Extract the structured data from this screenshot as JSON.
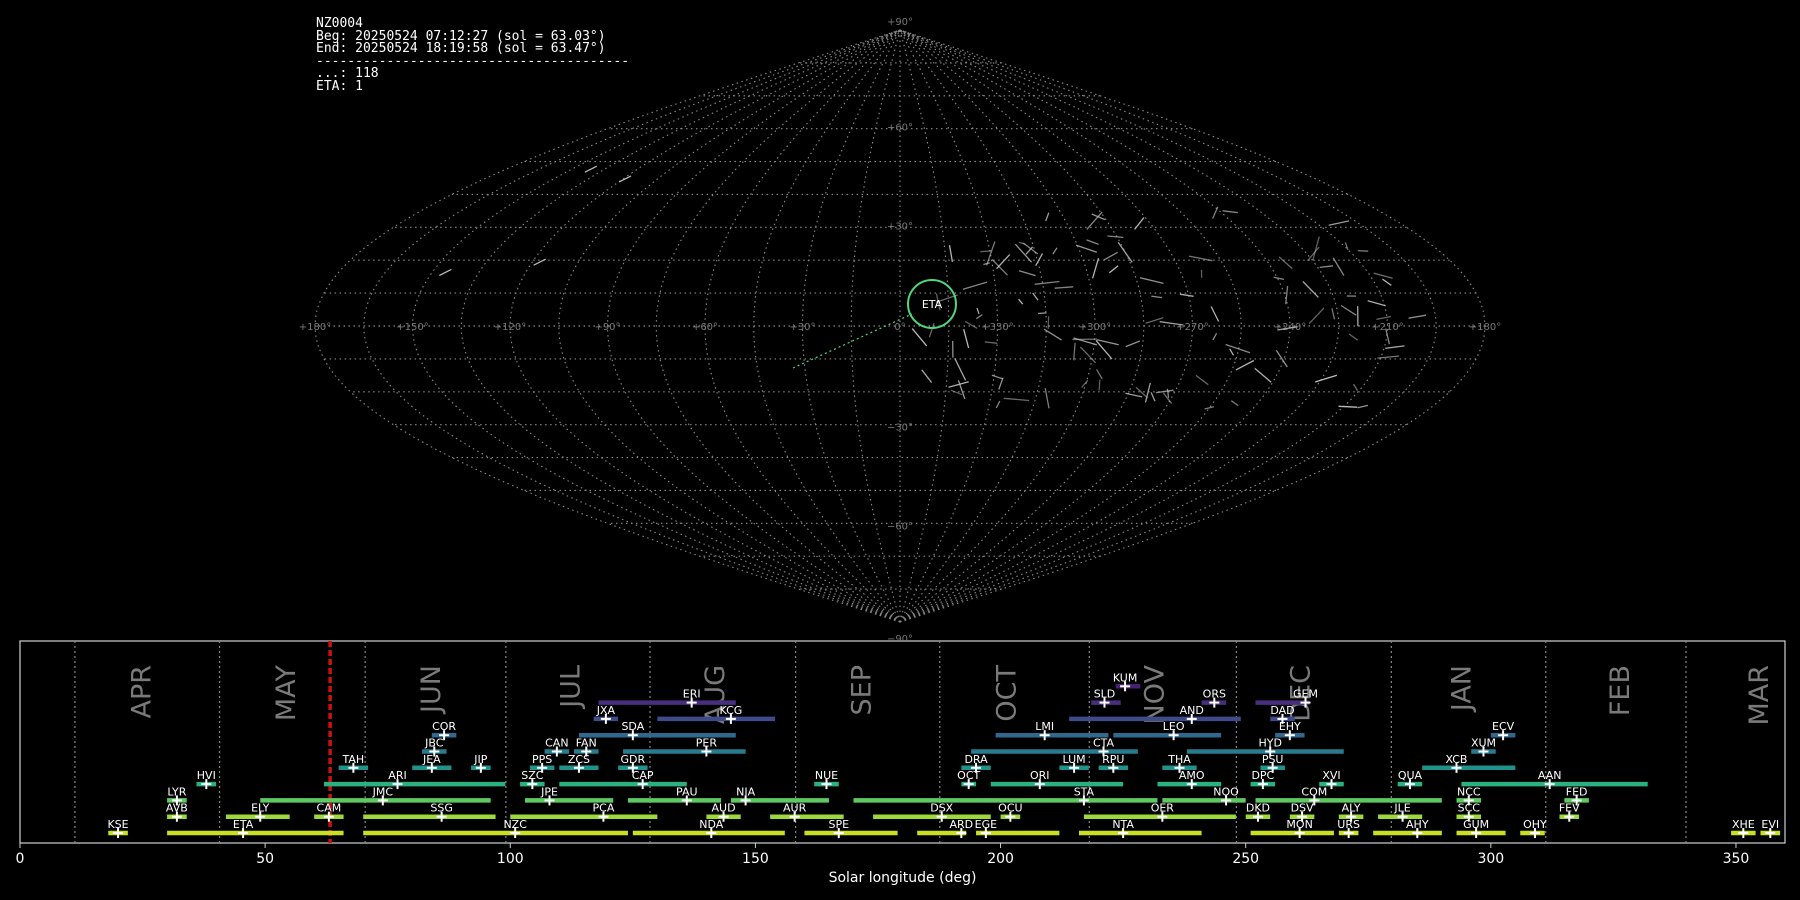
{
  "header": {
    "station": "NZ0004",
    "begin": "Beg: 20250524 07:12:27 (sol = 63.03°)",
    "end": "End: 20250524 18:19:58 (sol = 63.47°)",
    "separator": "----------------------------------------",
    "sporadic": "...: 118",
    "eta_count": "ETA: 1"
  },
  "sky_map": {
    "lat_labels": [
      "+90°",
      "+60°",
      "+30°",
      "0°",
      "−30°",
      "−60°",
      "−90°"
    ],
    "lon_labels": [
      "+180°",
      "+150°",
      "+120°",
      "+90°",
      "+60°",
      "+30°",
      "0°",
      "+330°",
      "+300°",
      "+270°",
      "+240°",
      "+210°",
      "+180°"
    ],
    "radiant_label": "ETA",
    "radiant_color": "#4fd77a",
    "grid_color": "#8a8a8a"
  },
  "chart_data": {
    "type": "timeline",
    "xlabel": "Solar longitude (deg)",
    "xlim": [
      0,
      360
    ],
    "xticks": [
      0,
      50,
      100,
      150,
      200,
      250,
      300,
      350
    ],
    "current_sol": 63.25,
    "current_sol_color": "#cc1111",
    "months": [
      {
        "name": "APR",
        "x": 24.6
      },
      {
        "name": "MAY",
        "x": 54.1
      },
      {
        "name": "JUN",
        "x": 83.6
      },
      {
        "name": "JUL",
        "x": 112.1
      },
      {
        "name": "AUG",
        "x": 141.6
      },
      {
        "name": "SEP",
        "x": 171.4
      },
      {
        "name": "OCT",
        "x": 201.0
      },
      {
        "name": "NOV",
        "x": 231.2
      },
      {
        "name": "DEC",
        "x": 261.0
      },
      {
        "name": "JAN",
        "x": 293.8
      },
      {
        "name": "FEB",
        "x": 326.1
      },
      {
        "name": "MAR",
        "x": 354.5
      }
    ],
    "month_boundaries": [
      11.2,
      40.7,
      70.4,
      99.1,
      128.5,
      158.2,
      187.6,
      218.1,
      248.1,
      279.7,
      311.2,
      339.8
    ],
    "showers": [
      {
        "code": "KUM",
        "start": 223.5,
        "end": 228.5,
        "peak": 225.4,
        "row": 10
      },
      {
        "code": "SLD",
        "start": 218.5,
        "end": 224.5,
        "peak": 221.2,
        "row": 9
      },
      {
        "code": "ORS",
        "start": 241.0,
        "end": 246.0,
        "peak": 243.6,
        "row": 9
      },
      {
        "code": "GEM",
        "start": 252.0,
        "end": 263.0,
        "peak": 262.2,
        "row": 9
      },
      {
        "code": "ERI",
        "start": 118.0,
        "end": 146.0,
        "peak": 137.0,
        "row": 9
      },
      {
        "code": "JXA",
        "start": 117.0,
        "end": 122.0,
        "peak": 119.5,
        "row": 8
      },
      {
        "code": "KCG",
        "start": 130.0,
        "end": 154.0,
        "peak": 145.0,
        "row": 8
      },
      {
        "code": "AND",
        "start": 214.0,
        "end": 249.0,
        "peak": 239.0,
        "row": 8
      },
      {
        "code": "DAD",
        "start": 255.0,
        "end": 260.0,
        "peak": 257.5,
        "row": 8
      },
      {
        "code": "COR",
        "start": 84.0,
        "end": 89.0,
        "peak": 86.5,
        "row": 7
      },
      {
        "code": "SDA",
        "start": 114.0,
        "end": 146.0,
        "peak": 125.0,
        "row": 7
      },
      {
        "code": "LMI",
        "start": 199.0,
        "end": 222.0,
        "peak": 209.0,
        "row": 7
      },
      {
        "code": "LEO",
        "start": 223.0,
        "end": 245.0,
        "peak": 235.3,
        "row": 7
      },
      {
        "code": "EHY",
        "start": 256.0,
        "end": 262.0,
        "peak": 259.0,
        "row": 7
      },
      {
        "code": "ECV",
        "start": 300.0,
        "end": 305.0,
        "peak": 302.5,
        "row": 7
      },
      {
        "code": "JBC",
        "start": 82.0,
        "end": 87.0,
        "peak": 84.5,
        "row": 6
      },
      {
        "code": "CAN",
        "start": 107.0,
        "end": 112.0,
        "peak": 109.5,
        "row": 6
      },
      {
        "code": "FAN",
        "start": 113.0,
        "end": 118.0,
        "peak": 115.5,
        "row": 6
      },
      {
        "code": "PER",
        "start": 123.0,
        "end": 148.0,
        "peak": 140.0,
        "row": 6
      },
      {
        "code": "CTA",
        "start": 194.0,
        "end": 228.0,
        "peak": 221.0,
        "row": 6
      },
      {
        "code": "HYD",
        "start": 238.0,
        "end": 270.0,
        "peak": 255.0,
        "row": 6
      },
      {
        "code": "XUM",
        "start": 296.0,
        "end": 301.0,
        "peak": 298.5,
        "row": 6
      },
      {
        "code": "TAH",
        "start": 65.0,
        "end": 71.0,
        "peak": 68.0,
        "row": 5
      },
      {
        "code": "JEA",
        "start": 80.0,
        "end": 88.0,
        "peak": 84.0,
        "row": 5
      },
      {
        "code": "JIP",
        "start": 92.0,
        "end": 96.0,
        "peak": 94.0,
        "row": 5
      },
      {
        "code": "PPS",
        "start": 104.0,
        "end": 109.0,
        "peak": 106.5,
        "row": 5
      },
      {
        "code": "ZCS",
        "start": 110.0,
        "end": 118.0,
        "peak": 114.0,
        "row": 5
      },
      {
        "code": "GDR",
        "start": 122.0,
        "end": 128.0,
        "peak": 125.0,
        "row": 5
      },
      {
        "code": "DRA",
        "start": 192.0,
        "end": 198.0,
        "peak": 195.0,
        "row": 5
      },
      {
        "code": "LUM",
        "start": 212.0,
        "end": 218.0,
        "peak": 215.0,
        "row": 5
      },
      {
        "code": "RPU",
        "start": 220.0,
        "end": 226.0,
        "peak": 223.0,
        "row": 5
      },
      {
        "code": "THA",
        "start": 233.0,
        "end": 240.0,
        "peak": 236.5,
        "row": 5
      },
      {
        "code": "PSU",
        "start": 253.0,
        "end": 258.0,
        "peak": 255.5,
        "row": 5
      },
      {
        "code": "XCB",
        "start": 286.0,
        "end": 305.0,
        "peak": 293.0,
        "row": 5
      },
      {
        "code": "HVI",
        "start": 36.0,
        "end": 40.0,
        "peak": 38.0,
        "row": 4
      },
      {
        "code": "ARI",
        "start": 62.0,
        "end": 99.0,
        "peak": 77.0,
        "row": 4
      },
      {
        "code": "SZC",
        "start": 102.0,
        "end": 107.0,
        "peak": 104.5,
        "row": 4
      },
      {
        "code": "CAP",
        "start": 110.0,
        "end": 136.0,
        "peak": 127.0,
        "row": 4
      },
      {
        "code": "NUE",
        "start": 162.0,
        "end": 167.0,
        "peak": 164.5,
        "row": 4
      },
      {
        "code": "OCT",
        "start": 192.0,
        "end": 195.0,
        "peak": 193.5,
        "row": 4
      },
      {
        "code": "ORI",
        "start": 198.0,
        "end": 225.0,
        "peak": 208.0,
        "row": 4
      },
      {
        "code": "AMO",
        "start": 232.0,
        "end": 245.0,
        "peak": 239.0,
        "row": 4
      },
      {
        "code": "DPC",
        "start": 251.0,
        "end": 256.0,
        "peak": 253.5,
        "row": 4
      },
      {
        "code": "XVI",
        "start": 265.0,
        "end": 270.0,
        "peak": 267.5,
        "row": 4
      },
      {
        "code": "QUA",
        "start": 281.0,
        "end": 286.0,
        "peak": 283.5,
        "row": 4
      },
      {
        "code": "AAN",
        "start": 294.0,
        "end": 332.0,
        "peak": 312.0,
        "row": 4
      },
      {
        "code": "LYR",
        "start": 30.0,
        "end": 34.0,
        "peak": 32.0,
        "row": 3
      },
      {
        "code": "JMC",
        "start": 49.0,
        "end": 96.0,
        "peak": 74.0,
        "row": 3
      },
      {
        "code": "JPE",
        "start": 103.0,
        "end": 121.0,
        "peak": 108.0,
        "row": 3
      },
      {
        "code": "PAU",
        "start": 124.0,
        "end": 143.0,
        "peak": 136.0,
        "row": 3
      },
      {
        "code": "NIA",
        "start": 145.0,
        "end": 165.0,
        "peak": 148.0,
        "row": 3
      },
      {
        "code": "STA",
        "start": 170.0,
        "end": 232.0,
        "peak": 217.0,
        "row": 3
      },
      {
        "code": "NOO",
        "start": 233.0,
        "end": 250.0,
        "peak": 246.0,
        "row": 3
      },
      {
        "code": "COM",
        "start": 252.0,
        "end": 290.0,
        "peak": 264.0,
        "row": 3
      },
      {
        "code": "NCC",
        "start": 293.0,
        "end": 298.0,
        "peak": 295.5,
        "row": 3
      },
      {
        "code": "FED",
        "start": 315.0,
        "end": 320.0,
        "peak": 317.5,
        "row": 3
      },
      {
        "code": "AVB",
        "start": 30.0,
        "end": 34.0,
        "peak": 32.0,
        "row": 2
      },
      {
        "code": "ELY",
        "start": 42.0,
        "end": 55.0,
        "peak": 49.0,
        "row": 2
      },
      {
        "code": "CAM",
        "start": 60.0,
        "end": 66.0,
        "peak": 63.0,
        "row": 2
      },
      {
        "code": "SSG",
        "start": 70.0,
        "end": 97.0,
        "peak": 86.0,
        "row": 2
      },
      {
        "code": "PCA",
        "start": 100.0,
        "end": 130.0,
        "peak": 119.0,
        "row": 2
      },
      {
        "code": "AUD",
        "start": 140.0,
        "end": 147.0,
        "peak": 143.5,
        "row": 2
      },
      {
        "code": "AUR",
        "start": 153.0,
        "end": 168.0,
        "peak": 158.0,
        "row": 2
      },
      {
        "code": "DSX",
        "start": 174.0,
        "end": 198.0,
        "peak": 188.0,
        "row": 2
      },
      {
        "code": "OCU",
        "start": 200.0,
        "end": 204.0,
        "peak": 202.0,
        "row": 2
      },
      {
        "code": "OER",
        "start": 217.0,
        "end": 248.0,
        "peak": 233.0,
        "row": 2
      },
      {
        "code": "DKD",
        "start": 250.0,
        "end": 255.0,
        "peak": 252.5,
        "row": 2
      },
      {
        "code": "DSV",
        "start": 259.0,
        "end": 264.0,
        "peak": 261.5,
        "row": 2
      },
      {
        "code": "ALY",
        "start": 269.0,
        "end": 274.0,
        "peak": 271.5,
        "row": 2
      },
      {
        "code": "JLE",
        "start": 277.0,
        "end": 286.0,
        "peak": 282.0,
        "row": 2
      },
      {
        "code": "SCC",
        "start": 293.0,
        "end": 298.0,
        "peak": 295.5,
        "row": 2
      },
      {
        "code": "FEV",
        "start": 314.0,
        "end": 318.0,
        "peak": 316.0,
        "row": 2
      },
      {
        "code": "KSE",
        "start": 18.0,
        "end": 22.0,
        "peak": 20.0,
        "row": 1
      },
      {
        "code": "ETA",
        "start": 30.0,
        "end": 66.0,
        "peak": 45.5,
        "row": 1
      },
      {
        "code": "NZC",
        "start": 70.0,
        "end": 124.0,
        "peak": 101.0,
        "row": 1
      },
      {
        "code": "NDA",
        "start": 125.0,
        "end": 156.0,
        "peak": 141.0,
        "row": 1
      },
      {
        "code": "SPE",
        "start": 160.0,
        "end": 179.0,
        "peak": 167.0,
        "row": 1
      },
      {
        "code": "ARD",
        "start": 183.0,
        "end": 193.0,
        "peak": 192.0,
        "row": 1
      },
      {
        "code": "EGE",
        "start": 195.0,
        "end": 212.0,
        "peak": 197.0,
        "row": 1
      },
      {
        "code": "NTA",
        "start": 216.0,
        "end": 241.0,
        "peak": 225.0,
        "row": 1
      },
      {
        "code": "MON",
        "start": 251.0,
        "end": 268.0,
        "peak": 261.0,
        "row": 1
      },
      {
        "code": "URS",
        "start": 269.0,
        "end": 273.0,
        "peak": 271.0,
        "row": 1
      },
      {
        "code": "AHY",
        "start": 276.0,
        "end": 290.0,
        "peak": 285.0,
        "row": 1
      },
      {
        "code": "GUM",
        "start": 293.0,
        "end": 303.0,
        "peak": 297.0,
        "row": 1
      },
      {
        "code": "OHY",
        "start": 306.0,
        "end": 311.0,
        "peak": 309.0,
        "row": 1
      },
      {
        "code": "XHE",
        "start": 349.0,
        "end": 354.0,
        "peak": 351.5,
        "row": 1
      },
      {
        "code": "EVI",
        "start": 355.0,
        "end": 359.0,
        "peak": 357.0,
        "row": 1
      }
    ]
  }
}
